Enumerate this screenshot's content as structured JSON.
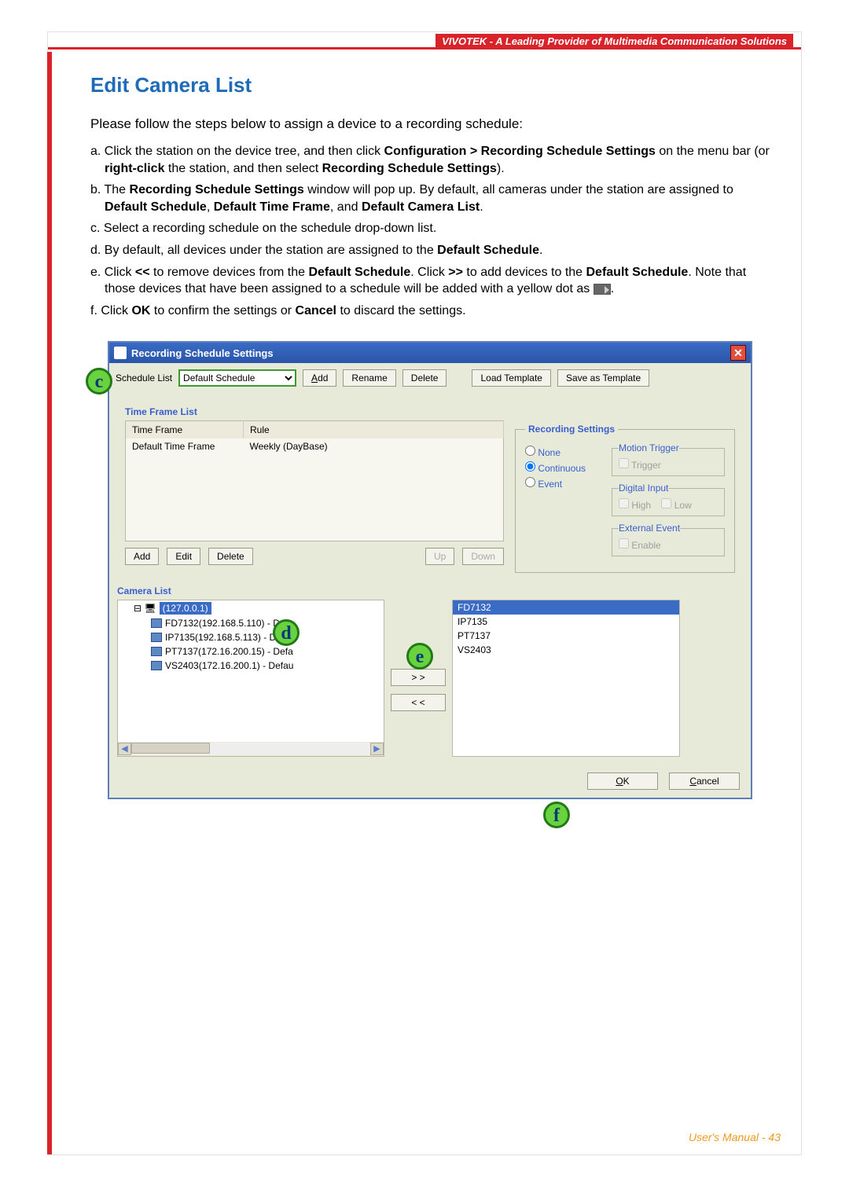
{
  "header": {
    "brand": "VIVOTEK - A Leading Provider of Multimedia Communication Solutions"
  },
  "page": {
    "title": "Edit Camera List",
    "intro": "Please follow the steps below to assign a device to a recording schedule:",
    "steps": {
      "a1": "a. Click the station on the device tree, and then click ",
      "a_bold1": "Configuration > Recording Schedule Settings",
      "a2": " on the menu bar (or ",
      "a_bold2": "right-click",
      "a3": " the station, and then select ",
      "a_bold3": "Recording Schedule Settings",
      "a4": ").",
      "b1": "b. The ",
      "b_bold1": "Recording Schedule Settings",
      "b2": " window will pop up. By default, all cameras under the station are assigned to ",
      "b_bold2": "Default Schedule",
      "b3": ", ",
      "b_bold3": "Default Time Frame",
      "b4": ", and ",
      "b_bold4": "Default Camera List",
      "b5": ".",
      "c": "c. Select a recording schedule on the schedule drop-down list.",
      "d1": "d. By default, all devices under the station are assigned to the ",
      "d_bold1": "Default Schedule",
      "d2": ".",
      "e1": "e. Click ",
      "e_bold1": "<<",
      "e2": " to remove devices from the ",
      "e_bold2": "Default Schedule",
      "e3": ". Click ",
      "e_bold3": ">>",
      "e4": " to add devices to the ",
      "e_bold4": "Default Schedule",
      "e5": ". Note that those devices that have been assigned to a schedule will be added with a yellow dot as ",
      "e6": ".",
      "f1": "f. Click ",
      "f_bold1": "OK",
      "f2": " to confirm the settings or ",
      "f_bold2": "Cancel",
      "f3": " to discard the settings."
    }
  },
  "dialog": {
    "title": "Recording Schedule Settings",
    "schedule_label": "Schedule List",
    "schedule_value": "Default Schedule",
    "btn_add": "Add",
    "btn_rename": "Rename",
    "btn_delete": "Delete",
    "btn_load": "Load Template",
    "btn_saveas": "Save as Template",
    "timeframe": {
      "label": "Time Frame List",
      "col_tf": "Time Frame",
      "col_rule": "Rule",
      "row_tf": "Default Time Frame",
      "row_rule": "Weekly (DayBase)",
      "btn_add": "Add",
      "btn_edit": "Edit",
      "btn_delete": "Delete",
      "btn_up": "Up",
      "btn_down": "Down"
    },
    "recset": {
      "label": "Recording Settings",
      "r_none": "None",
      "r_cont": "Continuous",
      "r_event": "Event",
      "mt": "Motion Trigger",
      "mt_trig": "Trigger",
      "di": "Digital Input",
      "di_high": "High",
      "di_low": "Low",
      "ee": "External Event",
      "ee_enable": "Enable"
    },
    "camera": {
      "label": "Camera List",
      "root": "(127.0.0.1)",
      "c1": "FD7132(192.168.5.110) - Defa",
      "c2": "IP7135(192.168.5.113) - Defa",
      "c3": "PT7137(172.16.200.15) - Defa",
      "c4": "VS2403(172.16.200.1) - Defau",
      "btn_rr": "> >",
      "btn_ll": "< <",
      "a1": "FD7132",
      "a2": "IP7135",
      "a3": "PT7137",
      "a4": "VS2403"
    },
    "ok": "OK",
    "cancel": "Cancel"
  },
  "callouts": {
    "c": "c",
    "d": "d",
    "e": "e",
    "f": "f"
  },
  "footer": "User's Manual - 43"
}
